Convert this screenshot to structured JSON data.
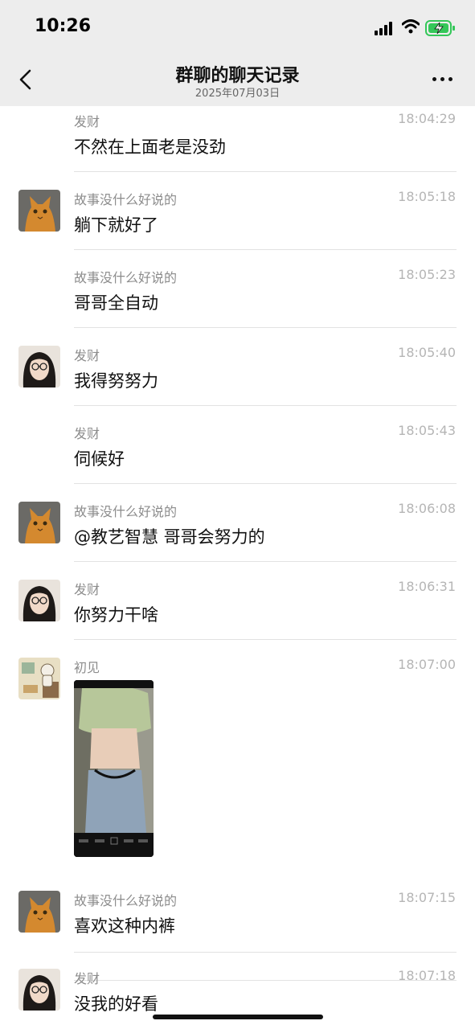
{
  "status_bar": {
    "time": "10:26"
  },
  "header": {
    "title": "群聊的聊天记录",
    "subtitle": "2025年07月03日"
  },
  "messages": [
    {
      "sender": "发财",
      "time": "18:04:29",
      "text": "不然在上面老是没劲",
      "avatar": "none"
    },
    {
      "sender": "故事没什么好说的",
      "time": "18:05:18",
      "text": "躺下就好了",
      "avatar": "orange-cat"
    },
    {
      "sender": "故事没什么好说的",
      "time": "18:05:23",
      "text": "哥哥全自动",
      "avatar": "none"
    },
    {
      "sender": "发财",
      "time": "18:05:40",
      "text": "我得努努力",
      "avatar": "girl-glasses"
    },
    {
      "sender": "发财",
      "time": "18:05:43",
      "text": "伺候好",
      "avatar": "none"
    },
    {
      "sender": "故事没什么好说的",
      "time": "18:06:08",
      "text": "@教艺智慧 哥哥会努力的",
      "avatar": "orange-cat"
    },
    {
      "sender": "发财",
      "time": "18:06:31",
      "text": "你努力干啥",
      "avatar": "girl-glasses"
    },
    {
      "sender": "初见",
      "time": "18:07:00",
      "text": "",
      "avatar": "cartoon-room",
      "image": "video-screenshot-thumbnail"
    },
    {
      "sender": "故事没什么好说的",
      "time": "18:07:15",
      "text": "喜欢这种内裤",
      "avatar": "orange-cat"
    },
    {
      "sender": "发财",
      "time": "18:07:18",
      "text": "没我的好看",
      "avatar": "girl-glasses"
    }
  ],
  "icons": {
    "back": "chevron-left-icon",
    "more": "more-dots-icon",
    "signal": "signal-icon",
    "wifi": "wifi-icon",
    "battery": "battery-charging-icon"
  },
  "colors": {
    "header_bg": "#ededed",
    "battery_green": "#34c759"
  }
}
